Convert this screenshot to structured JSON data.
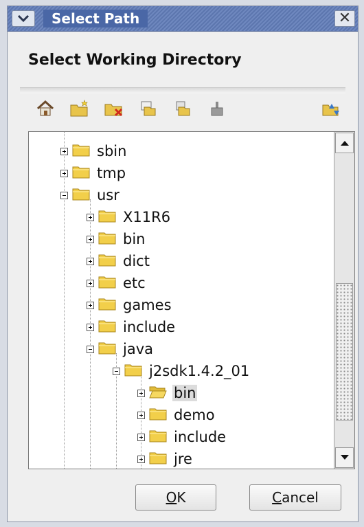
{
  "window": {
    "title": "Select Path",
    "heading": "Select Working Directory"
  },
  "toolbar": {
    "icons": [
      "home-icon",
      "new-folder-icon",
      "delete-folder-icon",
      "copy-icon",
      "paste-icon",
      "properties-icon",
      "refresh-icon"
    ]
  },
  "tree": {
    "items": [
      {
        "label": "sbin",
        "state": "collapsed"
      },
      {
        "label": "tmp",
        "state": "collapsed"
      },
      {
        "label": "usr",
        "state": "expanded"
      },
      {
        "label": "X11R6",
        "state": "collapsed"
      },
      {
        "label": "bin",
        "state": "collapsed"
      },
      {
        "label": "dict",
        "state": "collapsed"
      },
      {
        "label": "etc",
        "state": "collapsed"
      },
      {
        "label": "games",
        "state": "collapsed"
      },
      {
        "label": "include",
        "state": "collapsed"
      },
      {
        "label": "java",
        "state": "expanded"
      },
      {
        "label": "j2sdk1.4.2_01",
        "state": "expanded"
      },
      {
        "label": "bin",
        "state": "collapsed",
        "selected": true
      },
      {
        "label": "demo",
        "state": "collapsed"
      },
      {
        "label": "include",
        "state": "collapsed"
      },
      {
        "label": "jre",
        "state": "collapsed"
      }
    ]
  },
  "buttons": {
    "ok": {
      "mnemonic": "O",
      "rest": "K"
    },
    "cancel": {
      "mnemonic": "C",
      "rest": "ancel"
    }
  },
  "colors": {
    "titlebar": "#5c76ae",
    "folder": "#f2cf4a",
    "selection": "#dcdcdc"
  }
}
